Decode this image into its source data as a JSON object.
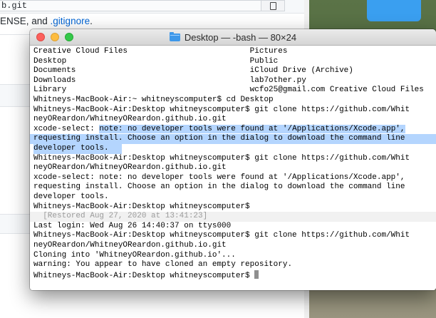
{
  "background_page": {
    "clone_url_visible": "b.git",
    "text_prefix": "ENSE, and ",
    "gitignore_link": ".gitignore",
    "text_suffix": "."
  },
  "terminal": {
    "title": "Desktop — -bash — 80×24",
    "lines": [
      {
        "text": "Creative Cloud Files                          Pictures"
      },
      {
        "text": "Desktop                                       Public"
      },
      {
        "text": "Documents                                     iCloud Drive (Archive)"
      },
      {
        "text": "Downloads                                     lab7other.py"
      },
      {
        "text": "Library                                       wcfo25@gmail.com Creative Cloud Files"
      },
      {
        "text": "Whitneys-MacBook-Air:~ whitneyscomputer$ cd Desktop"
      },
      {
        "text": "Whitneys-MacBook-Air:Desktop whitneyscomputer$ git clone https://github.com/Whit"
      },
      {
        "text": "neyOReardon/WhitneyOReardon.github.io.git"
      },
      {
        "prefix": "xcode-select: ",
        "text": "note: no developer tools were found at '/Applications/Xcode.app',"
      },
      {
        "text": "requesting install. Choose an option in the dialog to download the command line"
      },
      {
        "text": "developer tools."
      },
      {
        "text": "Whitneys-MacBook-Air:Desktop whitneyscomputer$ git clone https://github.com/Whit"
      },
      {
        "text": "neyOReardon/WhitneyOReardon.github.io.git"
      },
      {
        "text": "xcode-select: note: no developer tools were found at '/Applications/Xcode.app',"
      },
      {
        "text": "requesting install. Choose an option in the dialog to download the command line"
      },
      {
        "text": "developer tools."
      },
      {
        "text": "Whitneys-MacBook-Air:Desktop whitneyscomputer$"
      },
      {
        "text": "  [Restored Aug 27, 2020 at 13:41:23]"
      },
      {
        "text": "Last login: Wed Aug 26 14:40:37 on ttys000"
      },
      {
        "text": "Whitneys-MacBook-Air:Desktop whitneyscomputer$ git clone https://github.com/Whit"
      },
      {
        "text": "neyOReardon/WhitneyOReardon.github.io.git"
      },
      {
        "text": "Cloning into 'WhitneyOReardon.github.io'..."
      },
      {
        "text": "warning: You appear to have cloned an empty repository."
      },
      {
        "text": "Whitneys-MacBook-Air:Desktop whitneyscomputer$ "
      }
    ]
  },
  "colors": {
    "selection": "#b4d5fe",
    "link": "#0366d6",
    "desktop_folder": "#3a9ff0"
  },
  "icons": [
    "clipboard-icon",
    "folder-icon",
    "close-icon",
    "minimize-icon",
    "maximize-icon"
  ]
}
